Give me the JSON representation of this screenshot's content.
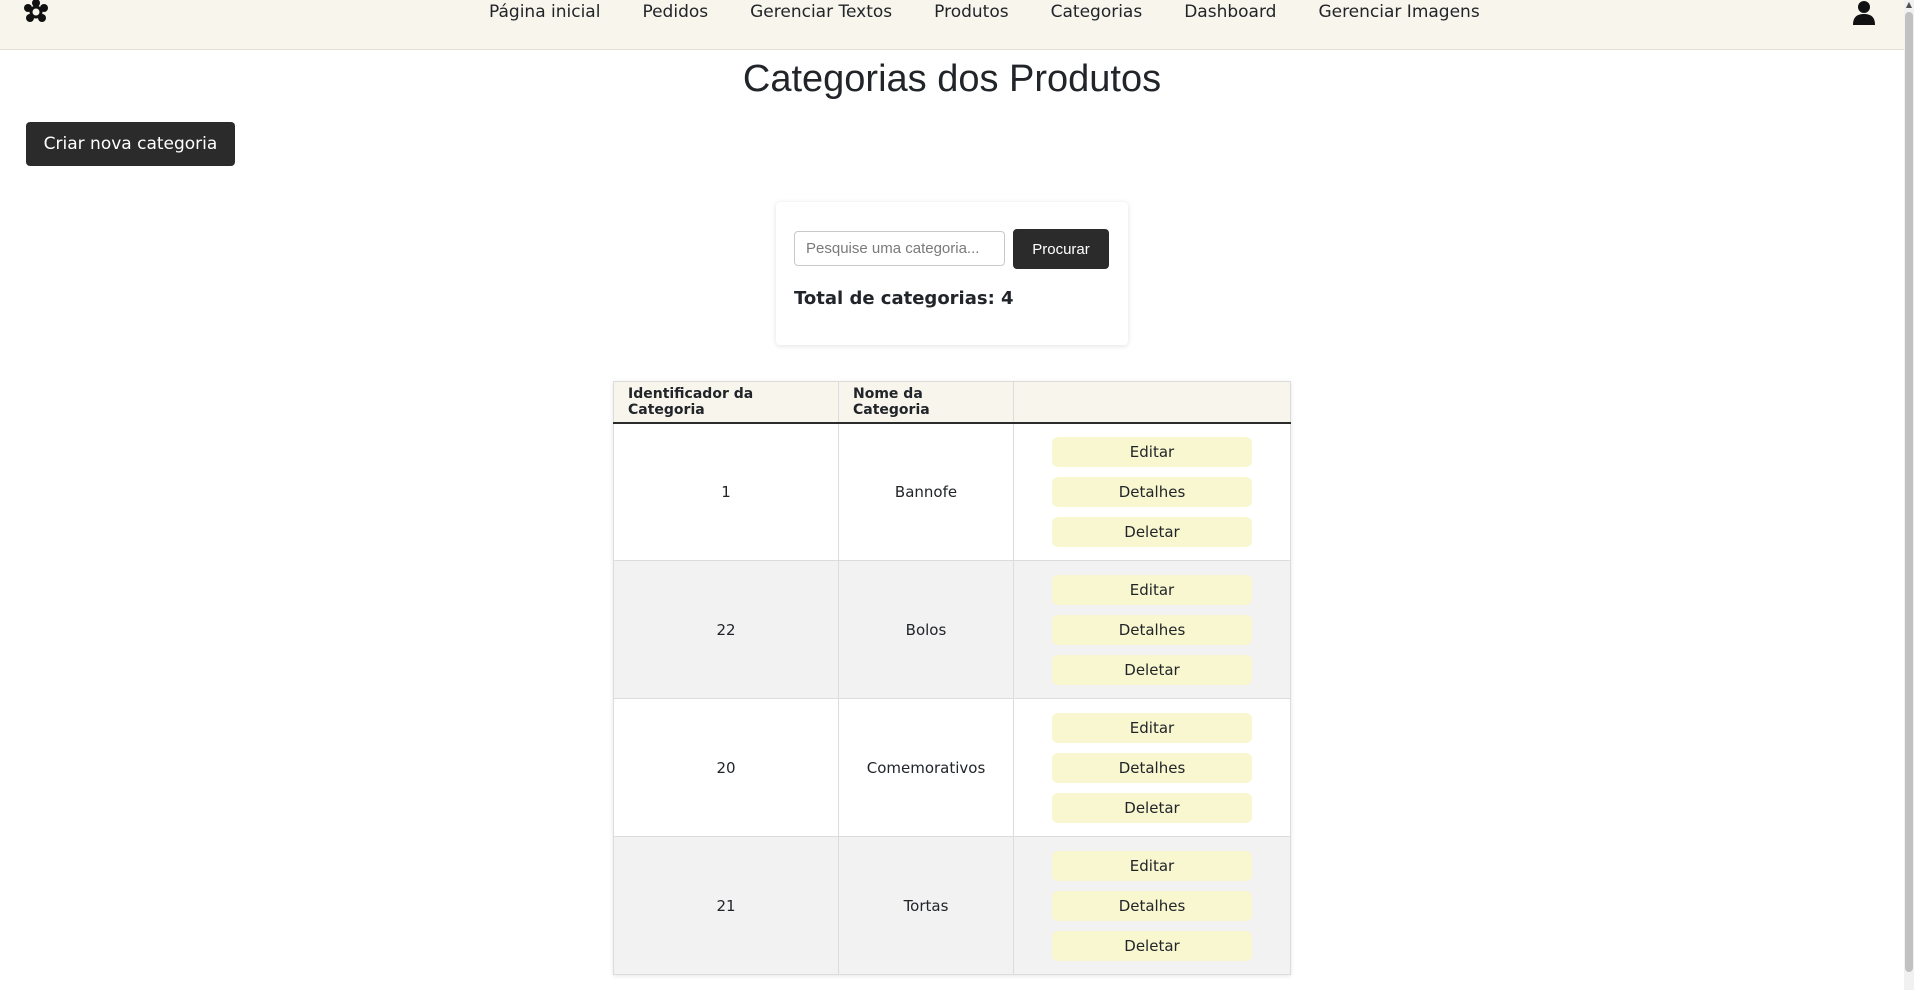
{
  "navbar": {
    "links": [
      "Página inicial",
      "Pedidos",
      "Gerenciar Textos",
      "Produtos",
      "Categorias",
      "Dashboard",
      "Gerenciar Imagens"
    ]
  },
  "page_title": "Categorias dos Produtos",
  "create_button": "Criar nova categoria",
  "search": {
    "placeholder": "Pesquise uma categoria...",
    "button": "Procurar",
    "total_label": "Total de categorias: 4"
  },
  "table": {
    "headers": [
      "Identificador da Categoria",
      "Nome da Categoria",
      ""
    ],
    "rows": [
      {
        "id": "1",
        "name": "Bannofe"
      },
      {
        "id": "22",
        "name": "Bolos"
      },
      {
        "id": "20",
        "name": "Comemorativos"
      },
      {
        "id": "21",
        "name": "Tortas"
      }
    ],
    "actions": {
      "edit": "Editar",
      "details": "Detalhes",
      "delete": "Deletar"
    }
  },
  "colors": {
    "navbar_bg": "#f8f5ec",
    "dark_button": "#2b2b2b",
    "action_button": "#f9f7cf"
  }
}
